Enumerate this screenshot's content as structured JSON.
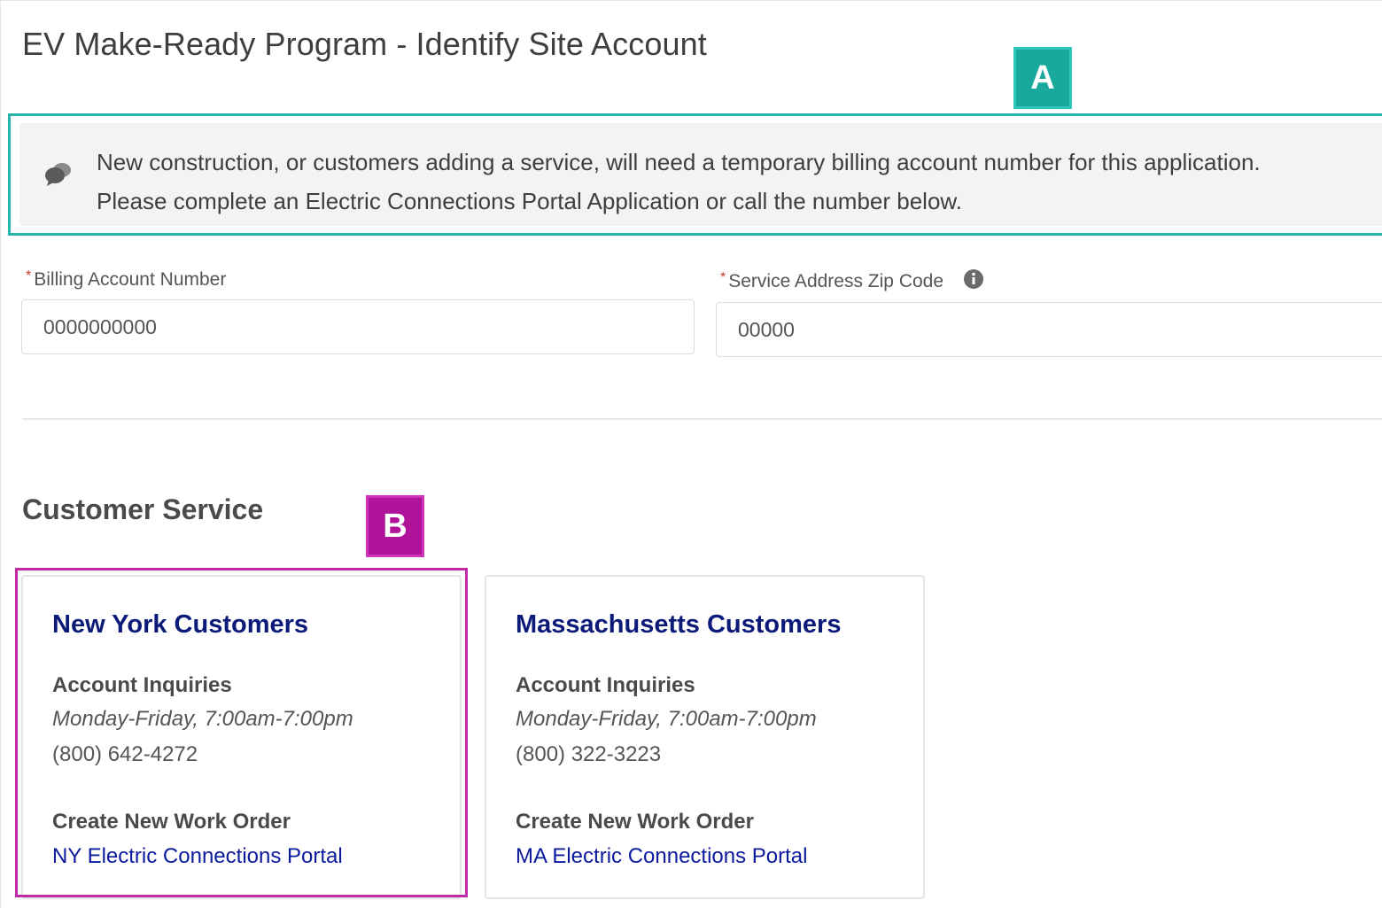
{
  "page": {
    "title": "EV Make-Ready Program - Identify Site Account"
  },
  "callouts": {
    "a": "A",
    "b": "B",
    "a_color": "#18a99c",
    "b_color": "#b0139a"
  },
  "notice": {
    "icon": "chat-bubbles-icon",
    "text": "New construction, or customers adding a service, will need a temporary billing account number for this application. Please complete an Electric Connections Portal Application or call the number below."
  },
  "form": {
    "required_marker": "*",
    "billing_account": {
      "label": "Billing Account Number",
      "placeholder": "0000000000"
    },
    "zip_code": {
      "label": "Service Address Zip Code",
      "placeholder": "00000",
      "info_icon": "info-icon"
    }
  },
  "customer_service": {
    "title": "Customer Service",
    "cards": [
      {
        "title": "New York Customers",
        "inquiries_label": "Account Inquiries",
        "hours": "Monday-Friday, 7:00am-7:00pm",
        "phone": "(800) 642-4272",
        "work_order_label": "Create New Work Order",
        "portal_link": "NY Electric Connections Portal"
      },
      {
        "title": "Massachusetts Customers",
        "inquiries_label": "Account Inquiries",
        "hours": "Monday-Friday, 7:00am-7:00pm",
        "phone": "(800) 322-3223",
        "work_order_label": "Create New Work Order",
        "portal_link": "MA Electric Connections Portal"
      }
    ]
  },
  "colors": {
    "card_title": "#0b1a78",
    "link": "#0b1a9e",
    "required": "#c23934"
  }
}
